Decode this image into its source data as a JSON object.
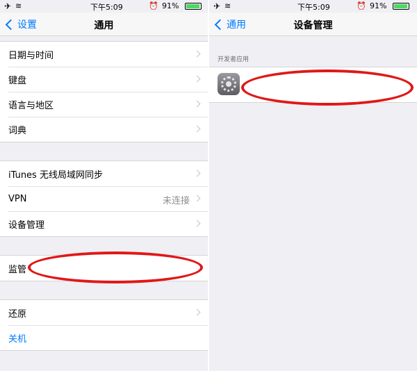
{
  "status": {
    "airplane_glyph": "✈",
    "wifi_glyph": "≋",
    "time": "下午5:09",
    "alarm_glyph": "⏰",
    "battery": "91%"
  },
  "left": {
    "back_label": "设置",
    "title": "通用",
    "group1": [
      {
        "label": "日期与时间"
      },
      {
        "label": "键盘"
      },
      {
        "label": "语言与地区"
      },
      {
        "label": "词典"
      }
    ],
    "group2": [
      {
        "label": "iTunes 无线局域网同步"
      },
      {
        "label": "VPN",
        "value": "未连接"
      },
      {
        "label": "设备管理"
      }
    ],
    "group3": [
      {
        "label": "监管"
      }
    ],
    "group4": [
      {
        "label": "还原"
      },
      {
        "label": "关机"
      }
    ]
  },
  "right": {
    "back_label": "通用",
    "title": "设备管理",
    "section_header": "开发者应用"
  },
  "icons": [
    "airplane-icon",
    "wifi-icon",
    "alarm-icon",
    "battery-icon",
    "back-chevron-icon",
    "chevron-right-icon",
    "settings-gear-icon"
  ],
  "colors": {
    "accent": "#007aff",
    "annotation": "#e01818",
    "background": "#efeff4"
  }
}
